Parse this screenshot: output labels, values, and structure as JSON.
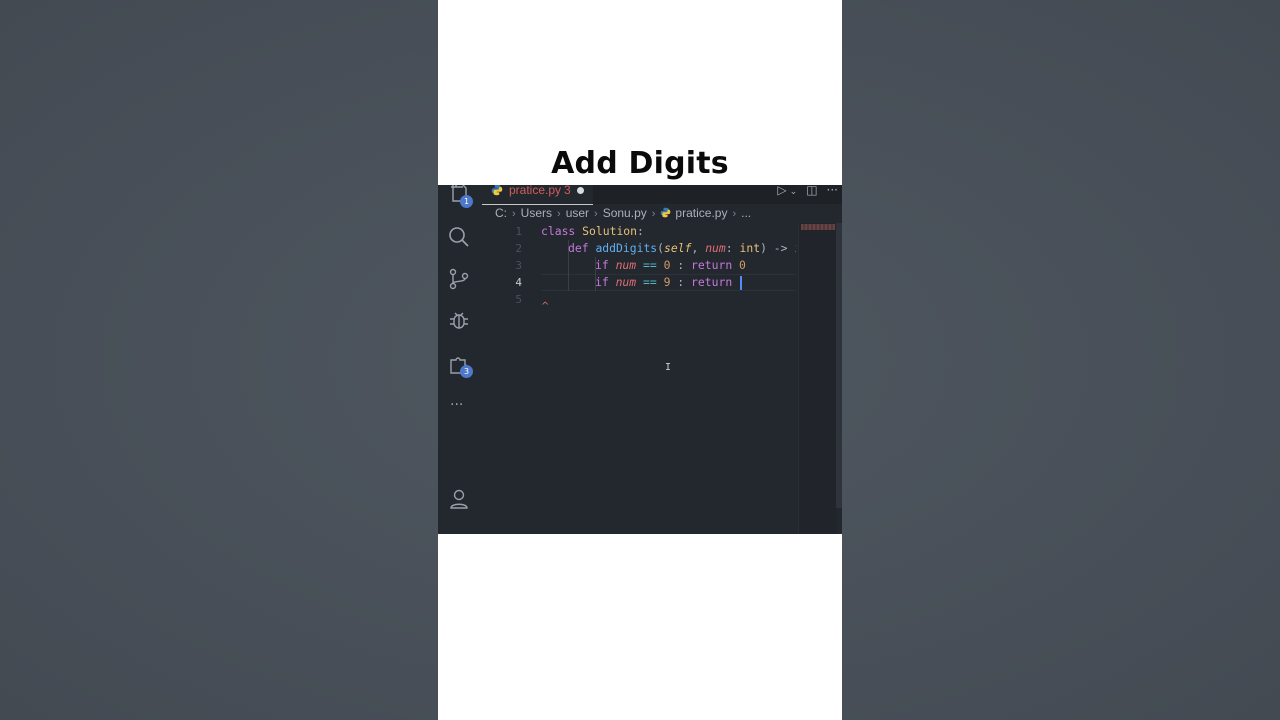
{
  "page": {
    "title": "Add Digits"
  },
  "tab": {
    "filename": "pratice.py",
    "problem_count": "3"
  },
  "activity_bar": {
    "explorer_badge": "1",
    "extensions_badge": "3",
    "more_label": "···"
  },
  "breadcrumbs": {
    "items": [
      "C:",
      "Users",
      "user",
      "Sonu.py",
      "pratice.py",
      "..."
    ]
  },
  "editor": {
    "line_numbers": [
      "1",
      "2",
      "3",
      "4",
      "5"
    ],
    "active_line": "4",
    "tokens": {
      "l1_kw": "class ",
      "l1_cls": "Solution",
      "l1_rest": ":",
      "l2_kw": "def ",
      "l2_fn": "addDigits",
      "l2_p1": "(",
      "l2_self": "self",
      "l2_c1": ", ",
      "l2_num": "num",
      "l2_c2": ": ",
      "l2_int": "int",
      "l2_c3": ") ",
      "l2_arrow": "->",
      "l2_c4": " i",
      "l3_if": "if ",
      "l3_num": "num",
      "l3_eq": " == ",
      "l3_val": "0",
      "l3_colon": " : ",
      "l3_ret": "return ",
      "l3_rval": "0",
      "l4_if": "if ",
      "l4_num": "num",
      "l4_eq": " == ",
      "l4_val": "9",
      "l4_colon": " : ",
      "l4_ret": "return "
    },
    "error_marker": "^"
  },
  "colors": {
    "editor_bg": "#23272e",
    "keyword": "#c678dd",
    "function": "#61afef",
    "class": "#e5c07b",
    "param": "#e06c75",
    "number": "#d19a66",
    "badge": "#4d78cc"
  }
}
